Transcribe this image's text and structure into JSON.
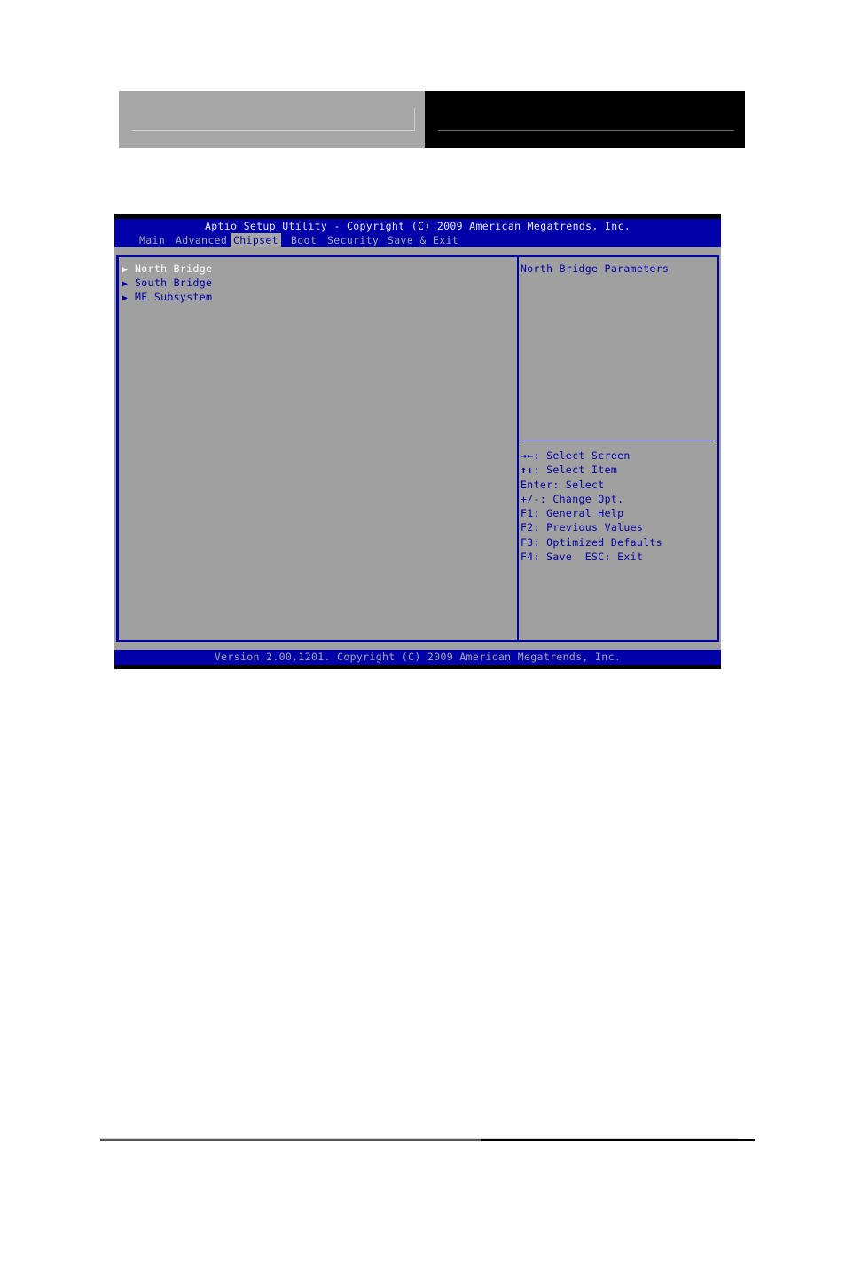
{
  "bios": {
    "title": "Aptio Setup Utility - Copyright (C) 2009 American Megatrends, Inc.",
    "tabs": [
      {
        "label": "Main",
        "active": false
      },
      {
        "label": "Advanced",
        "active": false
      },
      {
        "label": "Chipset",
        "active": true
      },
      {
        "label": "Boot",
        "active": false
      },
      {
        "label": "Security",
        "active": false
      },
      {
        "label": "Save & Exit",
        "active": false
      }
    ],
    "menu_items": [
      {
        "arrow": "▶",
        "label": "North Bridge",
        "selected": true
      },
      {
        "arrow": "▶",
        "label": "South Bridge",
        "selected": false
      },
      {
        "arrow": "▶",
        "label": "ME Subsystem",
        "selected": false
      }
    ],
    "help_text": "North Bridge Parameters",
    "keys": [
      {
        "key": "→←",
        "desc": ": Select Screen"
      },
      {
        "key": "↑↓",
        "desc": ": Select Item"
      },
      {
        "key": "Enter",
        "desc": ": Select"
      },
      {
        "key": "+/-",
        "desc": ": Change Opt."
      },
      {
        "key": "F1",
        "desc": ": General Help"
      },
      {
        "key": "F2",
        "desc": ": Previous Values"
      },
      {
        "key": "F3",
        "desc": ": Optimized Defaults"
      },
      {
        "key": "F4",
        "desc": ": Save  ESC: Exit"
      }
    ],
    "footer": "Version 2.00.1201. Copyright (C) 2009 American Megatrends, Inc.",
    "colors": {
      "blue": "#0000a8",
      "gray": "#a0a0a0",
      "selected_text": "#ffffff"
    }
  },
  "page_header": {
    "left_color": "#a6a6a6",
    "right_color": "#000000"
  }
}
